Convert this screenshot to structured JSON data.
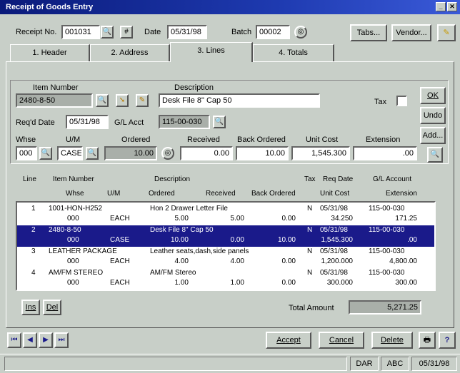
{
  "window": {
    "title": "Receipt of Goods Entry"
  },
  "header": {
    "receipt_no_label": "Receipt No.",
    "receipt_no": "001031",
    "date_label": "Date",
    "date": "05/31/98",
    "batch_label": "Batch",
    "batch": "00002",
    "tabs_button": "Tabs...",
    "vendor_button": "Vendor..."
  },
  "tabs": [
    {
      "label": "1. Header"
    },
    {
      "label": "2. Address"
    },
    {
      "label": "3. Lines"
    },
    {
      "label": "4. Totals"
    }
  ],
  "line_entry": {
    "item_number_label": "Item Number",
    "item_number": "2480-8-50",
    "description_label": "Description",
    "description": "Desk File 8\" Cap 50",
    "tax_label": "Tax",
    "reqd_date_label": "Req'd Date",
    "reqd_date": "05/31/98",
    "gl_acct_label": "G/L Acct",
    "gl_acct": "115-00-030",
    "whse_label": "Whse",
    "whse": "000",
    "um_label": "U/M",
    "um": "CASE",
    "ordered_label": "Ordered",
    "ordered": "10.00",
    "received_label": "Received",
    "received": "0.00",
    "back_ordered_label": "Back Ordered",
    "back_ordered": "10.00",
    "unit_cost_label": "Unit Cost",
    "unit_cost": "1,545.300",
    "extension_label": "Extension",
    "extension": ".00",
    "ok_button": "OK",
    "undo_button": "Undo",
    "add_button": "Add..."
  },
  "grid": {
    "headers_row1": [
      "Line",
      "Item Number",
      "Description",
      "Tax",
      "Req Date",
      "G/L Account"
    ],
    "headers_row2": [
      "Whse",
      "U/M",
      "Ordered",
      "Received",
      "Back Ordered",
      "Unit Cost",
      "Extension"
    ],
    "rows": [
      {
        "line": "1",
        "item": "1001-HON-H252",
        "description": "Hon 2 Drawer Letter File",
        "tax": "N",
        "date": "05/31/98",
        "gl": "115-00-030",
        "whse": "000",
        "um": "EACH",
        "ordered": "5.00",
        "received": "5.00",
        "back_ordered": "0.00",
        "unit_cost": "34.250",
        "extension": "171.25"
      },
      {
        "line": "2",
        "item": "2480-8-50",
        "description": "Desk File 8\" Cap 50",
        "tax": "N",
        "date": "05/31/98",
        "gl": "115-00-030",
        "whse": "000",
        "um": "CASE",
        "ordered": "10.00",
        "received": "0.00",
        "back_ordered": "10.00",
        "unit_cost": "1,545.300",
        "extension": ".00"
      },
      {
        "line": "3",
        "item": "LEATHER PACKAGE",
        "description": "Leather seats,dash,side panels",
        "tax": "N",
        "date": "05/31/98",
        "gl": "115-00-030",
        "whse": "000",
        "um": "EACH",
        "ordered": "4.00",
        "received": "4.00",
        "back_ordered": "0.00",
        "unit_cost": "1,200.000",
        "extension": "4,800.00"
      },
      {
        "line": "4",
        "item": "AM/FM STEREO",
        "description": "AM/FM Stereo",
        "tax": "N",
        "date": "05/31/98",
        "gl": "115-00-030",
        "whse": "000",
        "um": "EACH",
        "ordered": "1.00",
        "received": "1.00",
        "back_ordered": "0.00",
        "unit_cost": "300.000",
        "extension": "300.00"
      }
    ],
    "selected_row": 1
  },
  "footer": {
    "ins_button": "Ins",
    "del_button": "Del",
    "total_amount_label": "Total Amount",
    "total_amount": "5,271.25",
    "accept_button": "Accept",
    "cancel_button": "Cancel",
    "delete_button": "Delete",
    "help_button": "?"
  },
  "status": {
    "user": "DAR",
    "company": "ABC",
    "date": "05/31/98"
  },
  "colors": {
    "title_bar": "#0a1a7a",
    "selection": "#1a1a8a",
    "window_bg": "#c8cfc8"
  }
}
